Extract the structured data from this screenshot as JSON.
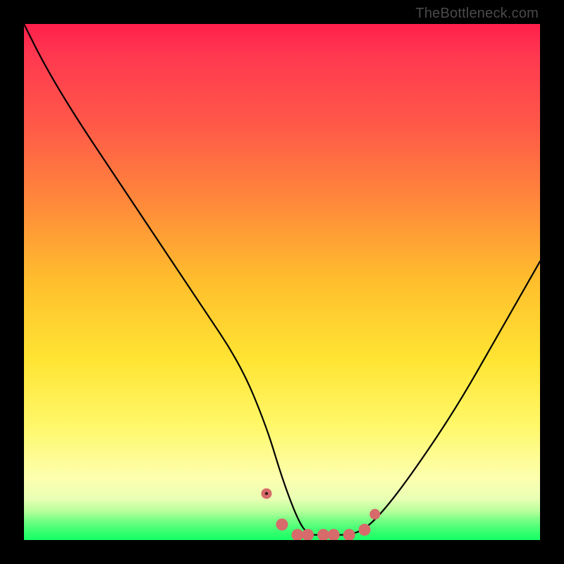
{
  "watermark": "TheBottleneck.com",
  "chart_data": {
    "type": "line",
    "title": "",
    "xlabel": "",
    "ylabel": "",
    "xlim": [
      0,
      100
    ],
    "ylim": [
      0,
      100
    ],
    "grid": false,
    "legend": false,
    "series": [
      {
        "name": "bottleneck-curve",
        "x": [
          0,
          4,
          10,
          18,
          26,
          34,
          42,
          47,
          50,
          53,
          55,
          58,
          60,
          63,
          66,
          70,
          76,
          84,
          92,
          100
        ],
        "y": [
          100,
          92,
          82,
          70,
          58,
          46,
          34,
          22,
          12,
          4,
          1,
          1,
          1,
          1,
          2,
          6,
          14,
          26,
          40,
          54
        ]
      }
    ],
    "markers": {
      "name": "highlight-dots",
      "color": "#d76a6a",
      "x": [
        47,
        50,
        53,
        55,
        58,
        60,
        63,
        66,
        68
      ],
      "y": [
        9,
        3,
        1,
        1,
        1,
        1,
        1,
        2,
        5
      ]
    },
    "gradient_stops": [
      {
        "pos": 0,
        "color": "#ff1f4b"
      },
      {
        "pos": 50,
        "color": "#ffbf2d"
      },
      {
        "pos": 88,
        "color": "#fdffaf"
      },
      {
        "pos": 100,
        "color": "#18ff66"
      }
    ]
  }
}
